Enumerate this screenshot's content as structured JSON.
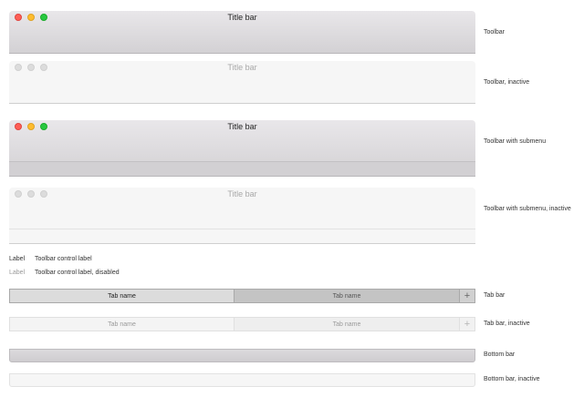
{
  "toolbars": [
    {
      "title": "Title bar",
      "caption": "Toolbar"
    },
    {
      "title": "Title bar",
      "caption": "Toolbar, inactive"
    },
    {
      "title": "Title bar",
      "caption": "Toolbar with submenu"
    },
    {
      "title": "Title bar",
      "caption": "Toolbar with submenu, inactive"
    }
  ],
  "labels": {
    "label_active": "Label",
    "label_active_caption": "Toolbar control label",
    "label_disabled": "Label",
    "label_disabled_caption": "Toolbar control label, disabled"
  },
  "tab_bars": [
    {
      "tabs": [
        "Tab name",
        "Tab name"
      ],
      "add_icon": "+",
      "caption": "Tab bar"
    },
    {
      "tabs": [
        "Tab name",
        "Tab name"
      ],
      "add_icon": "+",
      "caption": "Tab bar, inactive"
    }
  ],
  "bottom_bars": [
    {
      "caption": "Bottom bar"
    },
    {
      "caption": "Bottom bar, inactive"
    }
  ],
  "icons": {
    "close": "close-icon",
    "minimize": "minimize-icon",
    "zoom": "zoom-icon",
    "add_tab": "plus-icon"
  },
  "colors": {
    "close": "#fe5f57",
    "minimize": "#febc2e",
    "zoom": "#28c840",
    "traffic_inactive": "#dcdcdc"
  }
}
